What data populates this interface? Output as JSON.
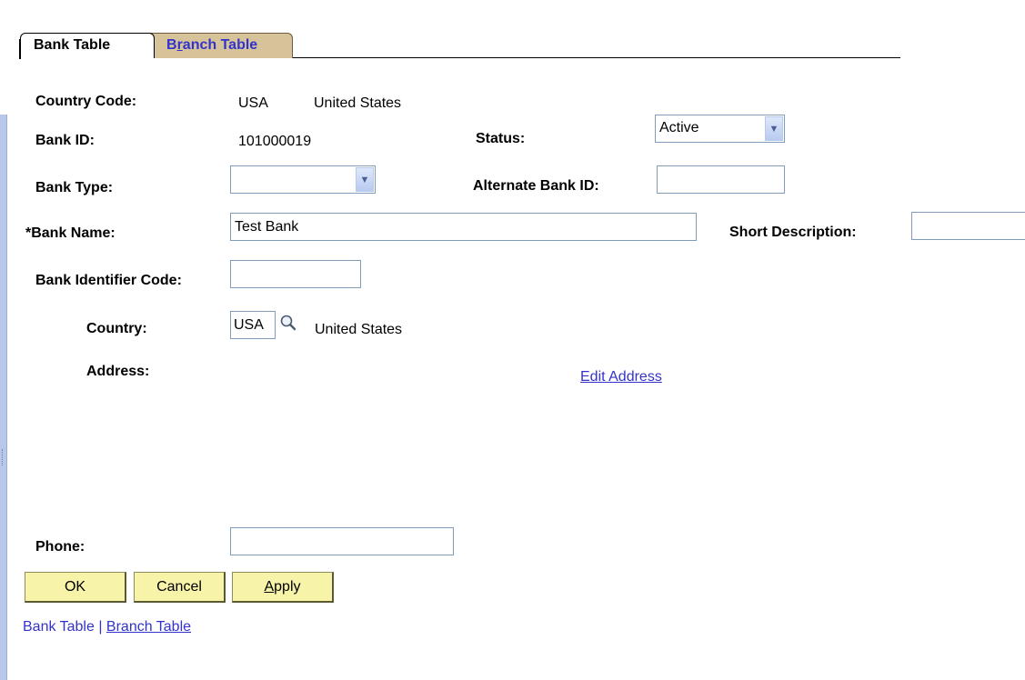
{
  "tabs": [
    {
      "label": "Bank Table",
      "active": true
    },
    {
      "label_prefix": "B",
      "label_mnemonic": "r",
      "label_suffix": "anch Table",
      "active": false
    }
  ],
  "fields": {
    "country_code": {
      "label": "Country Code:",
      "code": "USA",
      "description": "United States"
    },
    "bank_id": {
      "label": "Bank ID:",
      "value": "101000019"
    },
    "status": {
      "label": "Status:",
      "value": "Active"
    },
    "bank_type": {
      "label": "Bank Type:",
      "value": ""
    },
    "alternate_bank_id": {
      "label": "Alternate Bank ID:",
      "value": ""
    },
    "bank_name": {
      "label": "*Bank Name:",
      "value": "Test Bank"
    },
    "short_description": {
      "label": "Short Description:",
      "value": ""
    },
    "bank_identifier_code": {
      "label": "Bank Identifier Code:",
      "value": ""
    },
    "country": {
      "label": "Country:",
      "value": "USA",
      "description": "United States"
    },
    "address": {
      "label": "Address:",
      "edit_link": "Edit Address"
    },
    "phone": {
      "label": "Phone:",
      "value": ""
    }
  },
  "buttons": {
    "ok": "OK",
    "cancel": "Cancel",
    "apply_mnemonic": "A",
    "apply_rest": "pply"
  },
  "footer": {
    "current": "Bank Table",
    "separator": " | ",
    "link": "Branch Table"
  }
}
